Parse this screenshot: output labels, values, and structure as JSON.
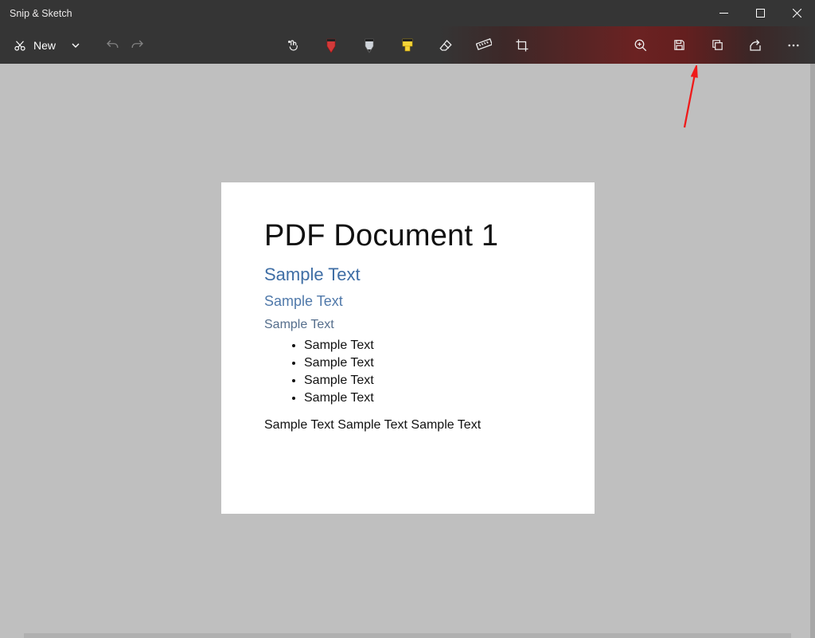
{
  "app": {
    "title": "Snip & Sketch"
  },
  "toolbar": {
    "new_label": "New"
  },
  "document": {
    "title": "PDF Document 1",
    "heading1": "Sample Text",
    "heading2": "Sample Text",
    "heading3": "Sample Text",
    "bullets": [
      "Sample Text",
      "Sample Text",
      "Sample Text",
      "Sample Text"
    ],
    "paragraph": "Sample Text Sample Text Sample Text"
  }
}
